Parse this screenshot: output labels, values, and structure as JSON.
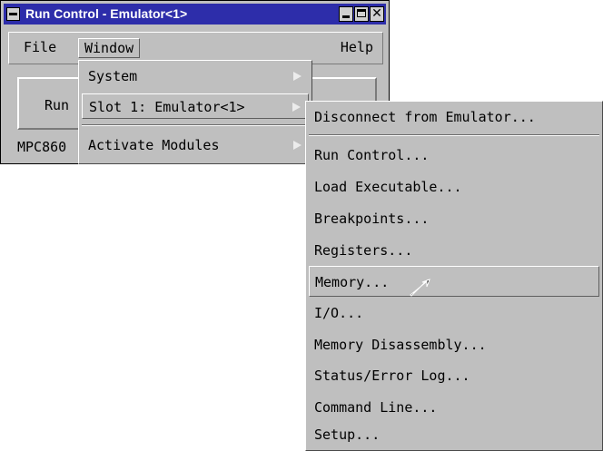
{
  "window": {
    "title": "Run Control - Emulator<1>"
  },
  "menubar": {
    "file": "File",
    "window": "Window",
    "help": "Help"
  },
  "main": {
    "run_label": "Run",
    "cpu_label": "MPC860"
  },
  "window_menu": {
    "items": [
      {
        "label": "System",
        "submenu": true
      },
      {
        "label": "Slot 1: Emulator<1>",
        "submenu": true,
        "highlighted": true
      },
      {
        "label": "Activate Modules",
        "submenu": true
      }
    ]
  },
  "slot_submenu": {
    "items": [
      {
        "label": "Disconnect from Emulator..."
      },
      {
        "label": "Run Control..."
      },
      {
        "label": "Load Executable..."
      },
      {
        "label": "Breakpoints..."
      },
      {
        "label": "Registers..."
      },
      {
        "label": "Memory...",
        "highlighted": true
      },
      {
        "label": "I/O..."
      },
      {
        "label": "Memory Disassembly..."
      },
      {
        "label": "Status/Error Log..."
      },
      {
        "label": "Command Line..."
      },
      {
        "label": "Setup..."
      }
    ]
  },
  "colors": {
    "titlebar": "#2d2daa",
    "face": "#bfbfbf"
  },
  "icons": {
    "pointer": "arrow-cursor-icon"
  }
}
